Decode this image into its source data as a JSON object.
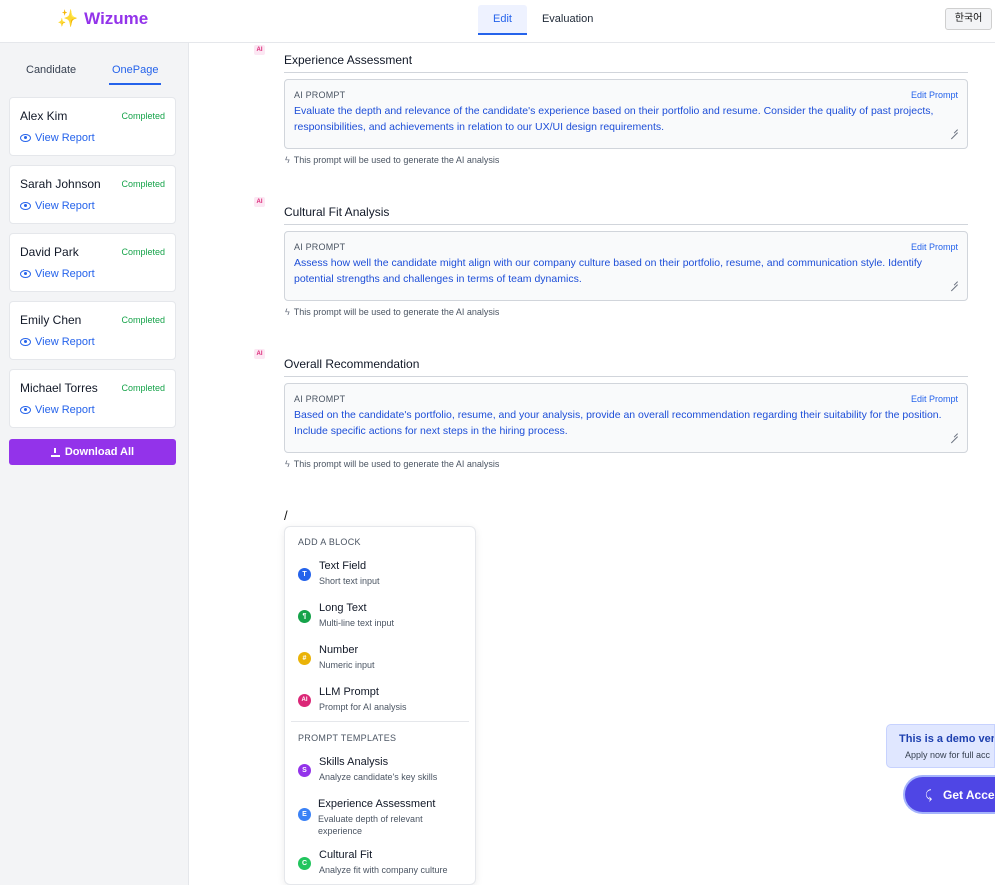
{
  "header": {
    "logo_icon": "✨",
    "logo_text": "Wizume",
    "tabs": [
      {
        "label": "Edit"
      },
      {
        "label": "Evaluation"
      }
    ],
    "language_button": "한국어"
  },
  "sidebar": {
    "tabs": [
      {
        "label": "Candidate"
      },
      {
        "label": "OnePage"
      }
    ],
    "candidates": [
      {
        "name": "Alex Kim",
        "status": "Completed",
        "link": "View Report"
      },
      {
        "name": "Sarah Johnson",
        "status": "Completed",
        "link": "View Report"
      },
      {
        "name": "David Park",
        "status": "Completed",
        "link": "View Report"
      },
      {
        "name": "Emily Chen",
        "status": "Completed",
        "link": "View Report"
      },
      {
        "name": "Michael Torres",
        "status": "Completed",
        "link": "View Report"
      }
    ],
    "download_label": "Download All"
  },
  "blocks": [
    {
      "badge": "AI",
      "title": "Experience Assessment",
      "prompt_label": "AI PROMPT",
      "edit_label": "Edit Prompt",
      "prompt_text": "Evaluate the depth and relevance of the candidate's experience based on their portfolio and resume. Consider the quality of past projects, responsibilities, and achievements in relation to our UX/UI design requirements.",
      "note": "This prompt will be used to generate the AI analysis"
    },
    {
      "badge": "AI",
      "title": "Cultural Fit Analysis",
      "prompt_label": "AI PROMPT",
      "edit_label": "Edit Prompt",
      "prompt_text": "Assess how well the candidate might align with our company culture based on their portfolio, resume, and communication style. Identify potential strengths and challenges in terms of team dynamics.",
      "note": "This prompt will be used to generate the AI analysis"
    },
    {
      "badge": "AI",
      "title": "Overall Recommendation",
      "prompt_label": "AI PROMPT",
      "edit_label": "Edit Prompt",
      "prompt_text": "Based on the candidate's portfolio, resume, and your analysis, provide an overall recommendation regarding their suitability for the position. Include specific actions for next steps in the hiring process.",
      "note": "This prompt will be used to generate the AI analysis"
    }
  ],
  "slash_input": "/",
  "dropdown": {
    "add_block_heading": "ADD A BLOCK",
    "blocks": [
      {
        "letter": "T",
        "title": "Text Field",
        "sub": "Short text input",
        "color": "#2563eb"
      },
      {
        "letter": "¶",
        "title": "Long Text",
        "sub": "Multi-line text input",
        "color": "#16a34a"
      },
      {
        "letter": "#",
        "title": "Number",
        "sub": "Numeric input",
        "color": "#eab308"
      },
      {
        "letter": "AI",
        "title": "LLM Prompt",
        "sub": "Prompt for AI analysis",
        "color": "#db2777"
      }
    ],
    "templates_heading": "PROMPT TEMPLATES",
    "templates": [
      {
        "letter": "S",
        "title": "Skills Analysis",
        "sub": "Analyze candidate's key skills",
        "color": "#9333ea"
      },
      {
        "letter": "E",
        "title": "Experience Assessment",
        "sub": "Evaluate depth of relevant experience",
        "color": "#3b82f6"
      },
      {
        "letter": "C",
        "title": "Cultural Fit",
        "sub": "Analyze fit with company culture",
        "color": "#22c55e"
      }
    ]
  },
  "demo": {
    "title": "This is a demo vers",
    "sub": "Apply now for full acc",
    "button_icon": "⤹",
    "button_label": "Get Acce"
  }
}
